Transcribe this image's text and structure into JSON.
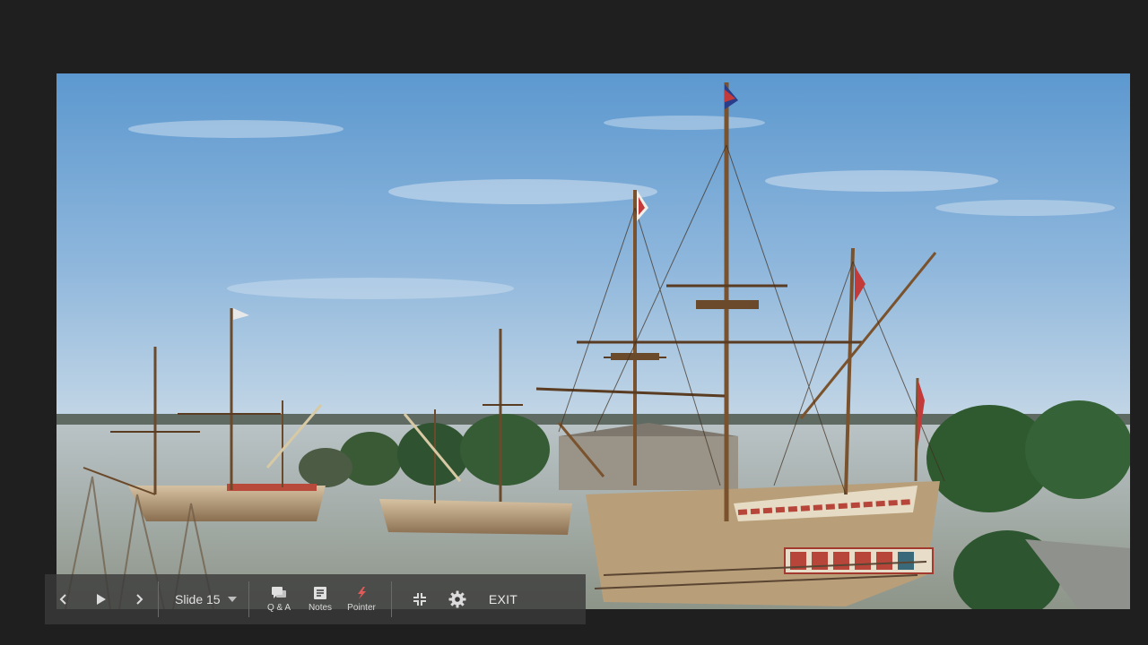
{
  "slide": {
    "image_description": "ships-at-dock-photo",
    "colors": {
      "background": "#1f1f1f",
      "sky_top": "#5e9bd0",
      "sky_bottom": "#bcd3e6",
      "water": "#a9b4b6",
      "hull": "#c9b08c",
      "trees": "#355c34"
    }
  },
  "toolbar": {
    "slide_label": "Slide 15",
    "qa_label": "Q & A",
    "notes_label": "Notes",
    "pointer_label": "Pointer",
    "exit_label": "EXIT",
    "pointer_color": "#e05a5a"
  }
}
